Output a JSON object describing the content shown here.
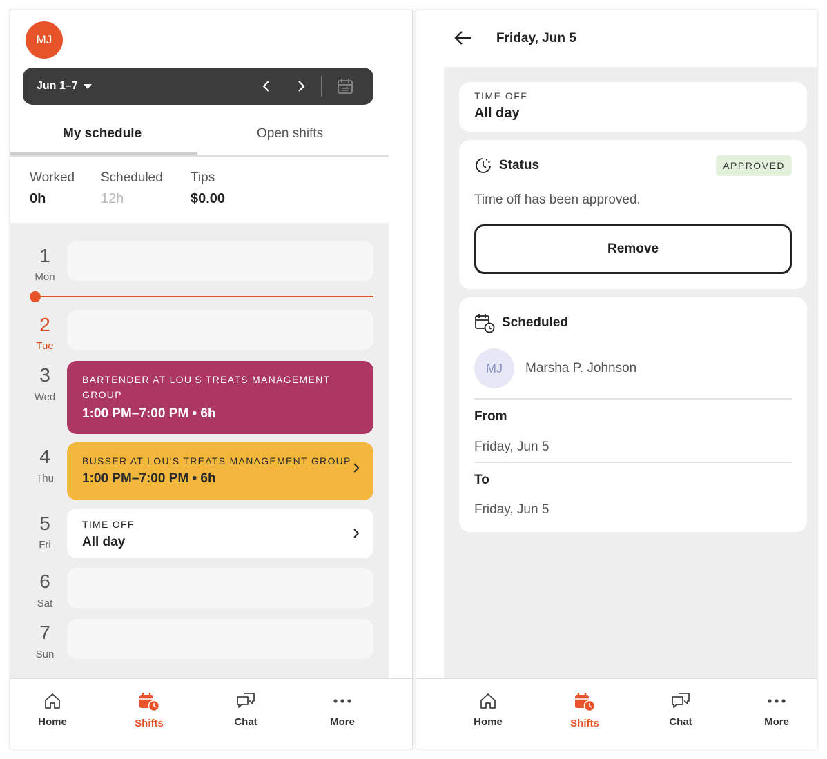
{
  "left": {
    "avatar_initials": "MJ",
    "week_range": "Jun 1–7",
    "tabs": {
      "my_schedule": "My schedule",
      "open_shifts": "Open shifts"
    },
    "stats": [
      {
        "label": "Worked",
        "value": "0h"
      },
      {
        "label": "Scheduled",
        "value": "12h"
      },
      {
        "label": "Tips",
        "value": "$0.00"
      }
    ],
    "days": [
      {
        "num": "1",
        "name": "Mon"
      },
      {
        "num": "2",
        "name": "Tue"
      },
      {
        "num": "3",
        "name": "Wed"
      },
      {
        "num": "4",
        "name": "Thu"
      },
      {
        "num": "5",
        "name": "Fri"
      },
      {
        "num": "6",
        "name": "Sat"
      },
      {
        "num": "7",
        "name": "Sun"
      }
    ],
    "shifts": {
      "bartender": {
        "role": "Bartender at Lou's Treats Management Group",
        "time": "1:00 PM–7:00 PM • 6h"
      },
      "busser": {
        "role": "Busser at Lou's Treats Management Group",
        "time": "1:00 PM–7:00 PM • 6h"
      },
      "timeoff": {
        "label": "TIME OFF",
        "value": "All day"
      }
    }
  },
  "right": {
    "title": "Friday, Jun 5",
    "timeoff_label": "TIME OFF",
    "timeoff_value": "All day",
    "status_title": "Status",
    "status_badge": "APPROVED",
    "status_text": "Time off has been approved.",
    "remove_label": "Remove",
    "scheduled_title": "Scheduled",
    "person_initials": "MJ",
    "person_name": "Marsha P. Johnson",
    "from_label": "From",
    "from_value": "Friday, Jun 5",
    "to_label": "To",
    "to_value": "Friday, Jun 5"
  },
  "nav": {
    "home": "Home",
    "shifts": "Shifts",
    "chat": "Chat",
    "more": "More"
  },
  "colors": {
    "accent": "#e8542a",
    "bartender": "#ac3762",
    "busser": "#f4b73e",
    "approved_bg": "#e3f1dc"
  }
}
